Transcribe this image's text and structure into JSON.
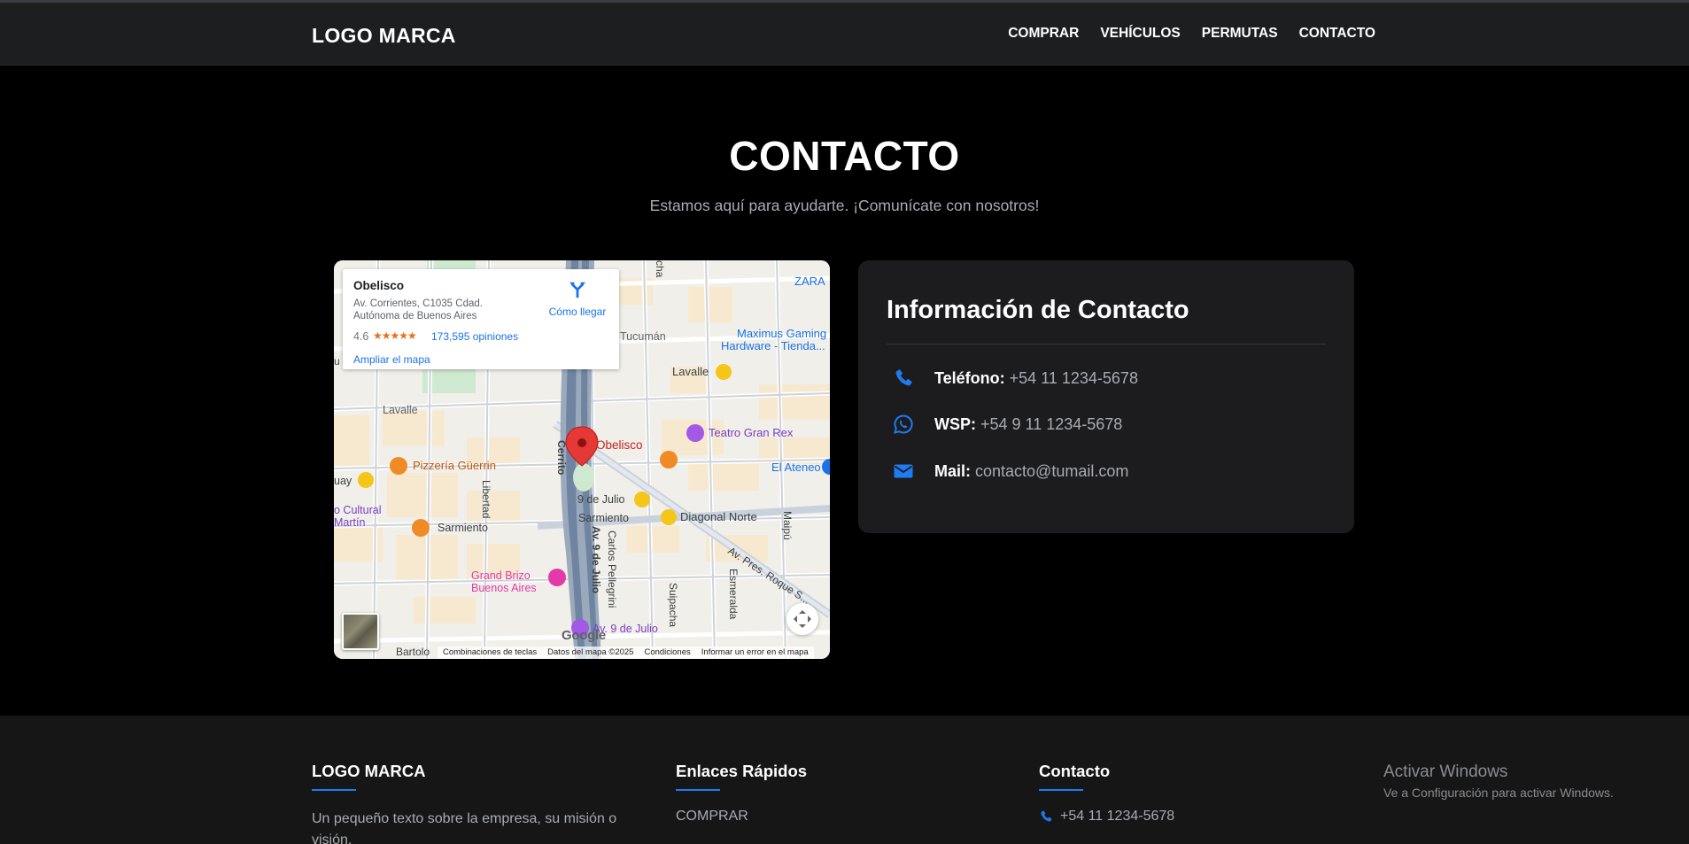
{
  "header": {
    "logo": "LOGO MARCA",
    "nav": [
      "COMPRAR",
      "VEHÍCULOS",
      "PERMUTAS",
      "CONTACTO"
    ]
  },
  "hero": {
    "title": "CONTACTO",
    "subtitle": "Estamos aquí para ayudarte. ¡Comunícate con nosotros!"
  },
  "map": {
    "place_name": "Obelisco",
    "address": "Av. Corrientes, C1035 Cdad. Autónoma de Buenos Aires",
    "rating": "4.6",
    "stars": "★★★★★",
    "reviews": "173,595 opiniones",
    "directions": "Cómo llegar",
    "enlarge": "Ampliar el mapa",
    "google": "Google",
    "attribution": [
      "Combinaciones de teclas",
      "Datos del mapa ©2025",
      "Condiciones",
      "Informar un error en el mapa"
    ],
    "labels": {
      "zara": "ZARA",
      "maximus_1": "Maximus Gaming",
      "maximus_2": "Hardware - Tienda...",
      "tucuman": "Tucumán",
      "lavalle_e": "Lavalle",
      "lavalle_w": "Lavalle",
      "obelisco": "Obelisco",
      "teatro": "Teatro Gran Rex",
      "ateneo": "El Ateneo",
      "guerrin": "Pizzería Güerrin",
      "uruguay": "uay",
      "cerrito": "Cerrito",
      "libertad": "Libertad",
      "nueve_julio": "9 de Julio",
      "diagonal": "Diagonal Norte",
      "maipu": "Maipú",
      "sarmiento_w": "Sarmiento",
      "sarmiento_e": "Sarmiento",
      "cultural_1": "o Cultural",
      "cultural_2": "Martín",
      "grand_brizo_1": "Grand Brizo",
      "grand_brizo_2": "Buenos Aires",
      "av_9_julio_v": "Av. 9 de Julio",
      "carlos_pellegrini": "Carlos Pellegrini",
      "suipacha": "Suipacha",
      "esmeralda": "Esmeralda",
      "roque": "Av. Pres. Roque S...",
      "av_9_julio_poi": "Av. 9 de Julio",
      "cha": "cha",
      "bartolome": "Bartolo",
      "u_cut": "u"
    }
  },
  "contact_card": {
    "title": "Información de Contacto",
    "rows": [
      {
        "icon": "phone-icon",
        "label": "Teléfono:",
        "value": "+54 11 1234-5678"
      },
      {
        "icon": "whatsapp-icon",
        "label": "WSP:",
        "value": "+54 9 11 1234-5678"
      },
      {
        "icon": "mail-icon",
        "label": "Mail:",
        "value": "contacto@tumail.com"
      }
    ]
  },
  "footer": {
    "col1": {
      "heading": "LOGO MARCA",
      "text": "Un pequeño texto sobre la empresa, su misión o visión."
    },
    "col2": {
      "heading": "Enlaces Rápidos",
      "link": "COMPRAR"
    },
    "col3": {
      "heading": "Contacto",
      "phone": "+54 11 1234-5678"
    }
  },
  "watermark": {
    "title": "Activar Windows",
    "subtitle": "Ve a Configuración para activar Windows."
  },
  "colors": {
    "accent": "#1e7bf0",
    "background": "#000000",
    "header": "#1d1e20",
    "card": "#1c1c1f",
    "muted_text": "#a8abb2"
  }
}
